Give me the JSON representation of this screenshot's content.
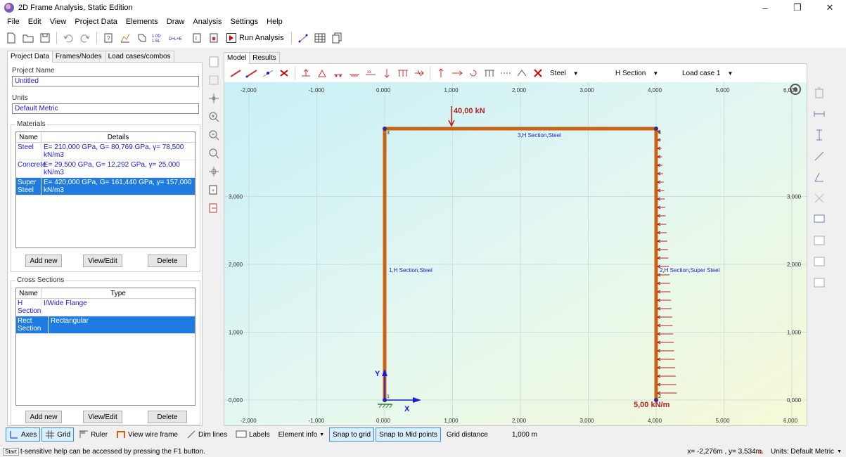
{
  "window": {
    "title": "2D Frame Analysis, Static Edition",
    "minimize": "–",
    "maximize": "❐",
    "close": "✕"
  },
  "menu": [
    "File",
    "Edit",
    "View",
    "Project Data",
    "Elements",
    "Draw",
    "Analysis",
    "Settings",
    "Help"
  ],
  "toolbar": {
    "run_label": "Run Analysis",
    "combo_badge_top": "1.0D",
    "combo_badge_bottom": "1.5L",
    "combo_chip": "D+L+E"
  },
  "left_tabs": [
    "Project Data",
    "Frames/Nodes",
    "Load cases/combos"
  ],
  "project": {
    "name_label": "Project Name",
    "name_value": "Untitled",
    "units_label": "Units",
    "units_value": "Default Metric"
  },
  "materials": {
    "title": "Materials",
    "col_name": "Name",
    "col_details": "Details",
    "rows": [
      {
        "name": "Steel",
        "details": "E= 210,000 GPa, G= 80,769 GPa, γ= 78,500 kN/m3"
      },
      {
        "name": "Concrete",
        "details": "E= 29,500 GPa, G= 12,292 GPa, γ= 25,000 kN/m3"
      },
      {
        "name": "Super Steel",
        "details": "E= 420,000 GPa, G= 161,440 GPa, γ= 157,000 kN/m3"
      }
    ],
    "selected_index": 2,
    "btn_add": "Add new",
    "btn_view": "View/Edit",
    "btn_delete": "Delete"
  },
  "sections": {
    "title": "Cross Sections",
    "col_name": "Name",
    "col_type": "Type",
    "rows": [
      {
        "name": "H Section",
        "type": "I/Wide Flange"
      },
      {
        "name": "Rect Section",
        "type": "Rectangular"
      }
    ],
    "selected_index": 1,
    "btn_add": "Add new",
    "btn_view": "View/Edit",
    "btn_delete": "Delete"
  },
  "model_tabs": [
    "Model",
    "Results"
  ],
  "element_toolbar": {
    "material": "Steel",
    "section": "H Section",
    "load_case": "Load case 1"
  },
  "canvas": {
    "x_ticks": [
      "-2,000",
      "-1,000",
      "0,000",
      "1,000",
      "2,000",
      "3,000",
      "4,000",
      "5,000",
      "6,000"
    ],
    "y_ticks": [
      "3,000",
      "2,000",
      "1,000",
      "0,000"
    ],
    "nodes": [
      "1",
      "2",
      "3",
      "4"
    ],
    "members": [
      {
        "label": "1,H Section,Steel"
      },
      {
        "label": "2,H Section,Super Steel"
      },
      {
        "label": "3,H Section,Steel"
      }
    ],
    "point_load": "40,00 kN",
    "dist_load": "5,00 kN/m",
    "axis_x": "X",
    "axis_y": "Y",
    "colors": {
      "frame": "#c86414",
      "load": "#b22222",
      "axis": "#1a1adb",
      "support": "#2e7d32"
    }
  },
  "bottom": {
    "axes": "Axes",
    "grid": "Grid",
    "ruler": "Ruler",
    "wire": "View wire frame",
    "dim": "Dim lines",
    "labels": "Labels",
    "element_info": "Element info",
    "snap_grid": "Snap to grid",
    "snap_mid": "Snap to Mid points",
    "grid_distance_label": "Grid distance",
    "grid_distance_value": "1,000 m"
  },
  "status": {
    "start": "Start",
    "message": "t-sensitive help can be accessed by pressing the F1 button.",
    "coords": "x= -2,276m , y= 3,534m",
    "units": "Units: Default Metric"
  }
}
